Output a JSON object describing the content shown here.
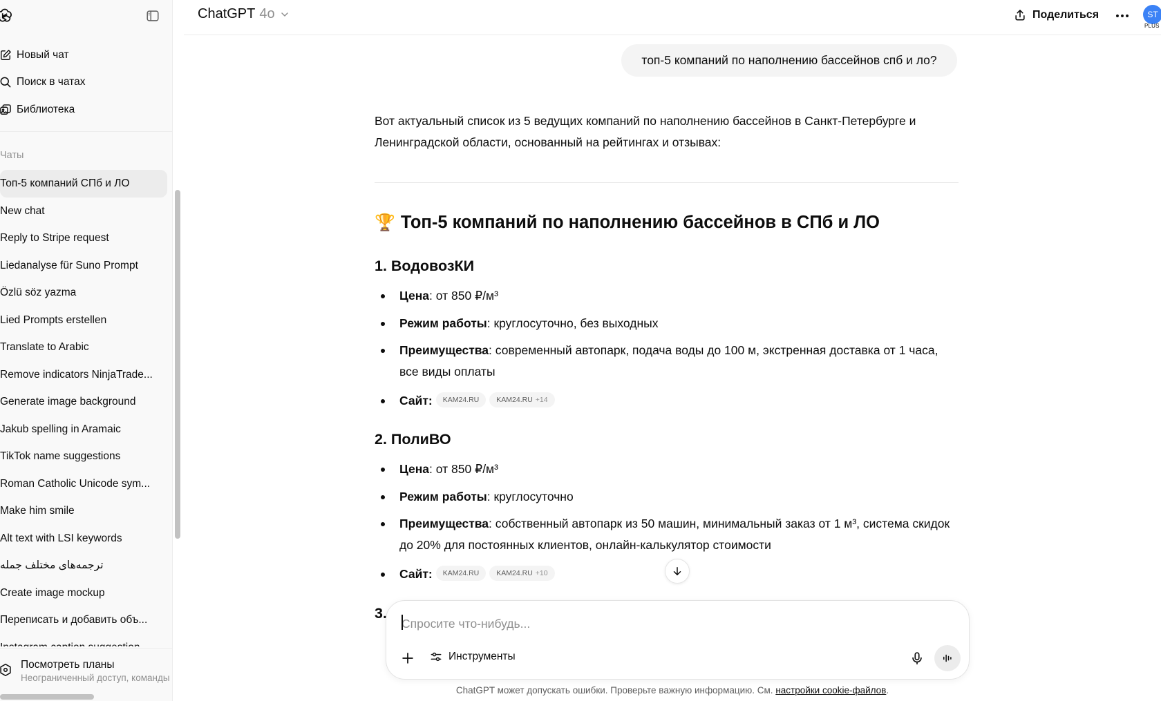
{
  "sidebar": {
    "nav": [
      {
        "label": "Новый чат",
        "icon": "new-chat-icon"
      },
      {
        "label": "Поиск в чатах",
        "icon": "search-icon"
      },
      {
        "label": "Библиотека",
        "icon": "library-icon"
      }
    ],
    "section_label": "Чаты",
    "chats": [
      "Топ-5 компаний СПб и ЛО",
      "New chat",
      "Reply to Stripe request",
      "Liedanalyse für Suno Prompt",
      "Özlü söz yazma",
      "Lied Prompts erstellen",
      "Translate to Arabic",
      "Remove indicators NinjaTrade...",
      "Generate image background",
      "Jakub spelling in Aramaic",
      "TikTok name suggestions",
      "Roman Catholic Unicode sym...",
      "Make him smile",
      "Alt text with LSI keywords",
      "ترجمه‌های مختلف جمله",
      "Create image mockup",
      "Переписать и добавить объ...",
      "Instagram caption suggestion"
    ],
    "plans": {
      "title": "Посмотреть планы",
      "subtitle": "Неограниченный доступ, команды"
    }
  },
  "header": {
    "model_name": "ChatGPT",
    "model_version": "4o",
    "share_label": "Поделиться",
    "avatar_initials": "ST",
    "plan_badge": "PLUS"
  },
  "conversation": {
    "user_message": "топ-5 компаний по наполнению бассейнов спб и ло?",
    "intro": "Вот актуальный список из 5 ведущих компаний по наполнению бассейнов в Санкт-Петербурге и Ленинградской области, основанный на рейтингах и отзывах:",
    "heading_emoji": "🏆",
    "heading": "Топ-5 компаний по наполнению бассейнов в СПб и ЛО",
    "companies": [
      {
        "title": "1. ВодовозКИ",
        "price_label": "Цена",
        "price": ": от 850 ₽/м³",
        "hours_label": "Режим работы",
        "hours": ": круглосуточно, без выходных",
        "benefits_label": "Преимущества",
        "benefits": ": современный автопарк, подача воды до 100 м, экстренная доставка от 1 часа, все виды оплаты",
        "site_label": "Сайт:",
        "chip1": "KAM24.RU",
        "chip2": "KAM24.RU",
        "chip2_more": "+14"
      },
      {
        "title": "2. ПолиВО",
        "price_label": "Цена",
        "price": ": от 850 ₽/м³",
        "hours_label": "Режим работы",
        "hours": ": круглосуточно",
        "benefits_label": "Преимущества",
        "benefits": ": собственный автопарк из 50 машин, минимальный заказ от 1 м³, система скидок до 20% для постоянных клиентов, онлайн-калькулятор стоимости",
        "site_label": "Сайт:",
        "chip1": "KAM24.RU",
        "chip2": "KAM24.RU",
        "chip2_more": "+10"
      }
    ],
    "next_heading_partial": "3."
  },
  "composer": {
    "placeholder": "Спросите что-нибудь...",
    "tools_label": "Инструменты"
  },
  "footer": {
    "note": "ChatGPT может допускать ошибки. Проверьте важную информацию. См.",
    "link": "настройки cookie-файлов",
    "suffix": "."
  },
  "colors": {
    "accent": "#3b82f6",
    "sidebar_bg": "#f9f9f9",
    "bubble_bg": "#f4f4f4",
    "text": "#0d0d0d",
    "muted": "#8f8f8f"
  }
}
